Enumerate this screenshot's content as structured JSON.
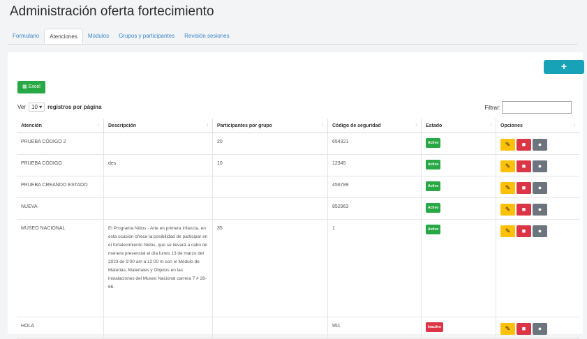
{
  "page": {
    "title": "Administración oferta fortecimiento"
  },
  "tabs": [
    {
      "label": "Formulario",
      "active": false
    },
    {
      "label": "Atenciones",
      "active": true
    },
    {
      "label": "Módulos",
      "active": false
    },
    {
      "label": "Grupos y participantes",
      "active": false
    },
    {
      "label": "Revisión sesiones",
      "active": false
    }
  ],
  "toolbar": {
    "add_label": "+",
    "excel_label": "Excel"
  },
  "list_controls": {
    "show_label": "Ver",
    "page_size": "10",
    "per_page_label": "registros por página",
    "filter_label": "Filtrar:",
    "filter_value": ""
  },
  "table": {
    "headers": [
      "Atención",
      "Descripción",
      "Participantes por grupo",
      "Código de seguridad",
      "Estado",
      "Opciones"
    ],
    "rows": [
      {
        "atencion": "PRUEBA CÓDIGO 2",
        "descripcion": "",
        "participantes": "20",
        "codigo": "654321",
        "estado": "Activo"
      },
      {
        "atencion": "PRUEBA CÓDIGO",
        "descripcion": "des",
        "participantes": "10",
        "codigo": "12345",
        "estado": "Activo"
      },
      {
        "atencion": "PRUEBA CREANDO ESTADO",
        "descripcion": "",
        "participantes": "",
        "codigo": "456789",
        "estado": "Activo"
      },
      {
        "atencion": "NUEVA",
        "descripcion": "",
        "participantes": "",
        "codigo": "852963",
        "estado": "Activo"
      },
      {
        "atencion": "MUSEO NACIONAL",
        "descripcion": "El Programa Nidos - Arte en primera infancia, en esta ocasión ofrece la posibilidad de participar en el fortalecimiento Nidos, que se llevará a cabo de manera presencial el día lunes 13 de marzo del 2023 de 9:00 am a 12:00 m con el Módulo de Materias, Materiales y Objetos en las instalaciones del Museo Nacional carrera 7 # 28-66.",
        "participantes": "35",
        "codigo": "1",
        "estado": "Activo"
      },
      {
        "atencion": "HOLA",
        "descripcion": "",
        "participantes": "",
        "codigo": "951",
        "estado": "Inactivo"
      }
    ]
  },
  "colors": {
    "accent": "#17a2b8",
    "success": "#28a745",
    "danger": "#dc3545",
    "warning": "#ffc107",
    "secondary": "#6c757d"
  },
  "icons": {
    "edit": "pencil-icon",
    "delete": "trash-icon",
    "groups": "users-icon"
  }
}
